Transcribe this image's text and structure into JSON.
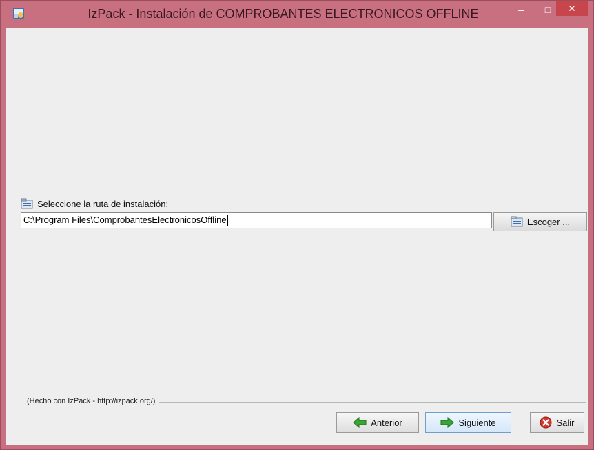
{
  "window": {
    "title": "IzPack - Instalación de  COMPROBANTES ELECTRONICOS OFFLINE",
    "app_icon": "izpack-app-icon",
    "controls": {
      "minimize": "–",
      "maximize": "□",
      "close": "✕"
    }
  },
  "panel": {
    "path_label": "Seleccione la ruta de instalación:",
    "path_value": "C:\\Program Files\\ComprobantesElectronicosOffline",
    "browse_label": "Escoger ..."
  },
  "footer": {
    "credit": "(Hecho con IzPack - http://izpack.org/)"
  },
  "buttons": {
    "previous": "Anterior",
    "next": "Siguiente",
    "exit": "Salir"
  },
  "colors": {
    "titlebar": "#c86f80",
    "close_button": "#c7464b",
    "client_bg": "#eeeeee",
    "arrow_green": "#3aa636"
  }
}
